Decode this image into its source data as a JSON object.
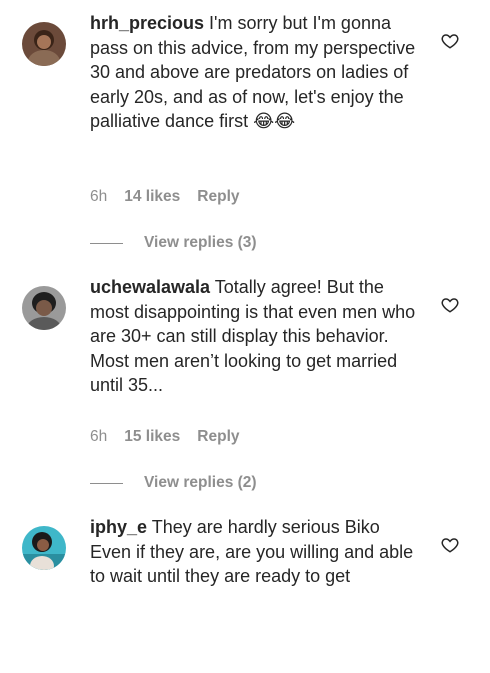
{
  "comments": [
    {
      "username": "hrh_precious",
      "text": "I'm sorry but I'm gonna pass on this advice, from my perspective 30 and above are predators on ladies of early 20s, and as of now, let's enjoy the palliative dance first 😂😂",
      "time": "6h",
      "likes": "14 likes",
      "reply_label": "Reply",
      "view_replies": "View replies (3)",
      "avatar_icon": "user-avatar",
      "like_icon": "heart-outline-icon"
    },
    {
      "username": "uchewalawala",
      "text": "Totally agree! But the most disappointing is that even men who are 30+ can still display this behavior. Most men aren’t looking to get married until 35...",
      "time": "6h",
      "likes": "15 likes",
      "reply_label": "Reply",
      "view_replies": "View replies (2)",
      "avatar_icon": "user-avatar",
      "like_icon": "heart-outline-icon"
    },
    {
      "username": "iphy_e",
      "text": "They are hardly serious Biko Even if they are, are you willing and able to wait until they are ready to get",
      "avatar_icon": "user-avatar",
      "like_icon": "heart-outline-icon"
    }
  ],
  "colors": {
    "text": "#262626",
    "secondary": "#8e8e8e",
    "background": "#ffffff"
  }
}
